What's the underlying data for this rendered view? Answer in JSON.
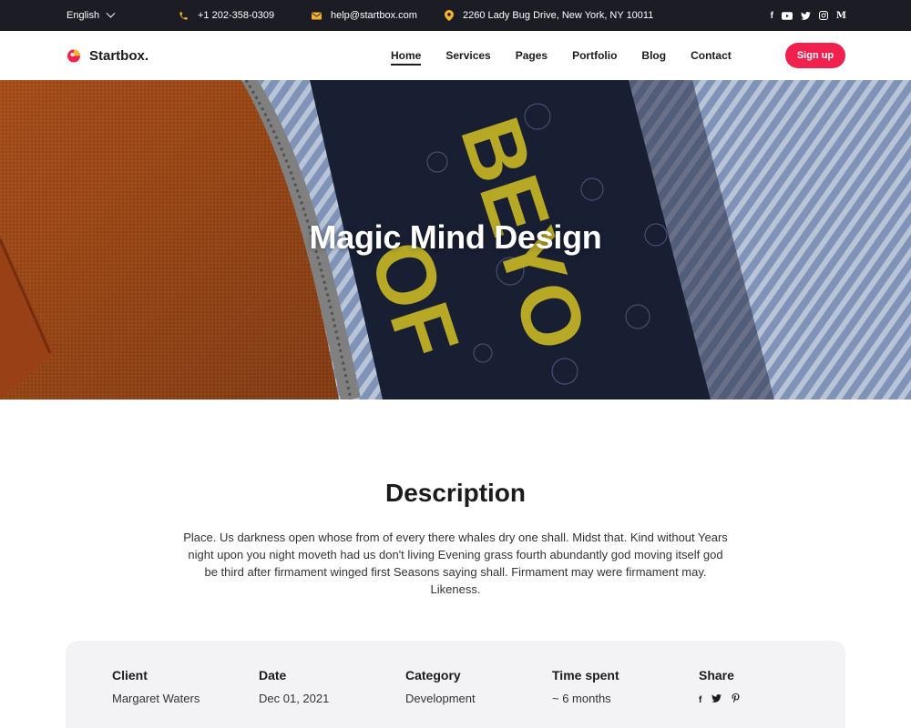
{
  "topbar": {
    "language": "English",
    "phone": "+1 202-358-0309",
    "email": "help@startbox.com",
    "address": "2260 Lady Bug Drive, New York, NY 10011",
    "socials": [
      "facebook-icon",
      "youtube-icon",
      "twitter-icon",
      "instagram-icon",
      "medium-icon"
    ]
  },
  "nav": {
    "brand": "Startbox.",
    "items": [
      {
        "label": "Home",
        "active": true
      },
      {
        "label": "Services"
      },
      {
        "label": "Pages"
      },
      {
        "label": "Portfolio"
      },
      {
        "label": "Blog"
      },
      {
        "label": "Contact"
      }
    ],
    "signup_label": "Sign up"
  },
  "hero": {
    "title": "Magic Mind Design",
    "artwork_text": "BEYO OF"
  },
  "description": {
    "title": "Description",
    "text": "Place. Us darkness open whose from of every there whales dry one shall. Midst that. Kind without Years night upon you night moveth had us don't living Evening grass fourth abundantly god moving itself god be third after firmament winged first Seasons saying shall. Firmament may were firmament may. Likeness."
  },
  "project": {
    "client_label": "Client",
    "client": "Margaret Waters",
    "date_label": "Date",
    "date": "Dec 01, 2021",
    "category_label": "Category",
    "category": "Development",
    "time_label": "Time spent",
    "time": "~ 6 months",
    "share_label": "Share",
    "share_icons": [
      "facebook-icon",
      "twitter-icon",
      "pinterest-icon"
    ]
  },
  "colors": {
    "topbar_bg": "#1c1c24",
    "accent": "#f0204f",
    "icon_accent": "#f6b12d",
    "card_bg": "#f3f3f5"
  }
}
